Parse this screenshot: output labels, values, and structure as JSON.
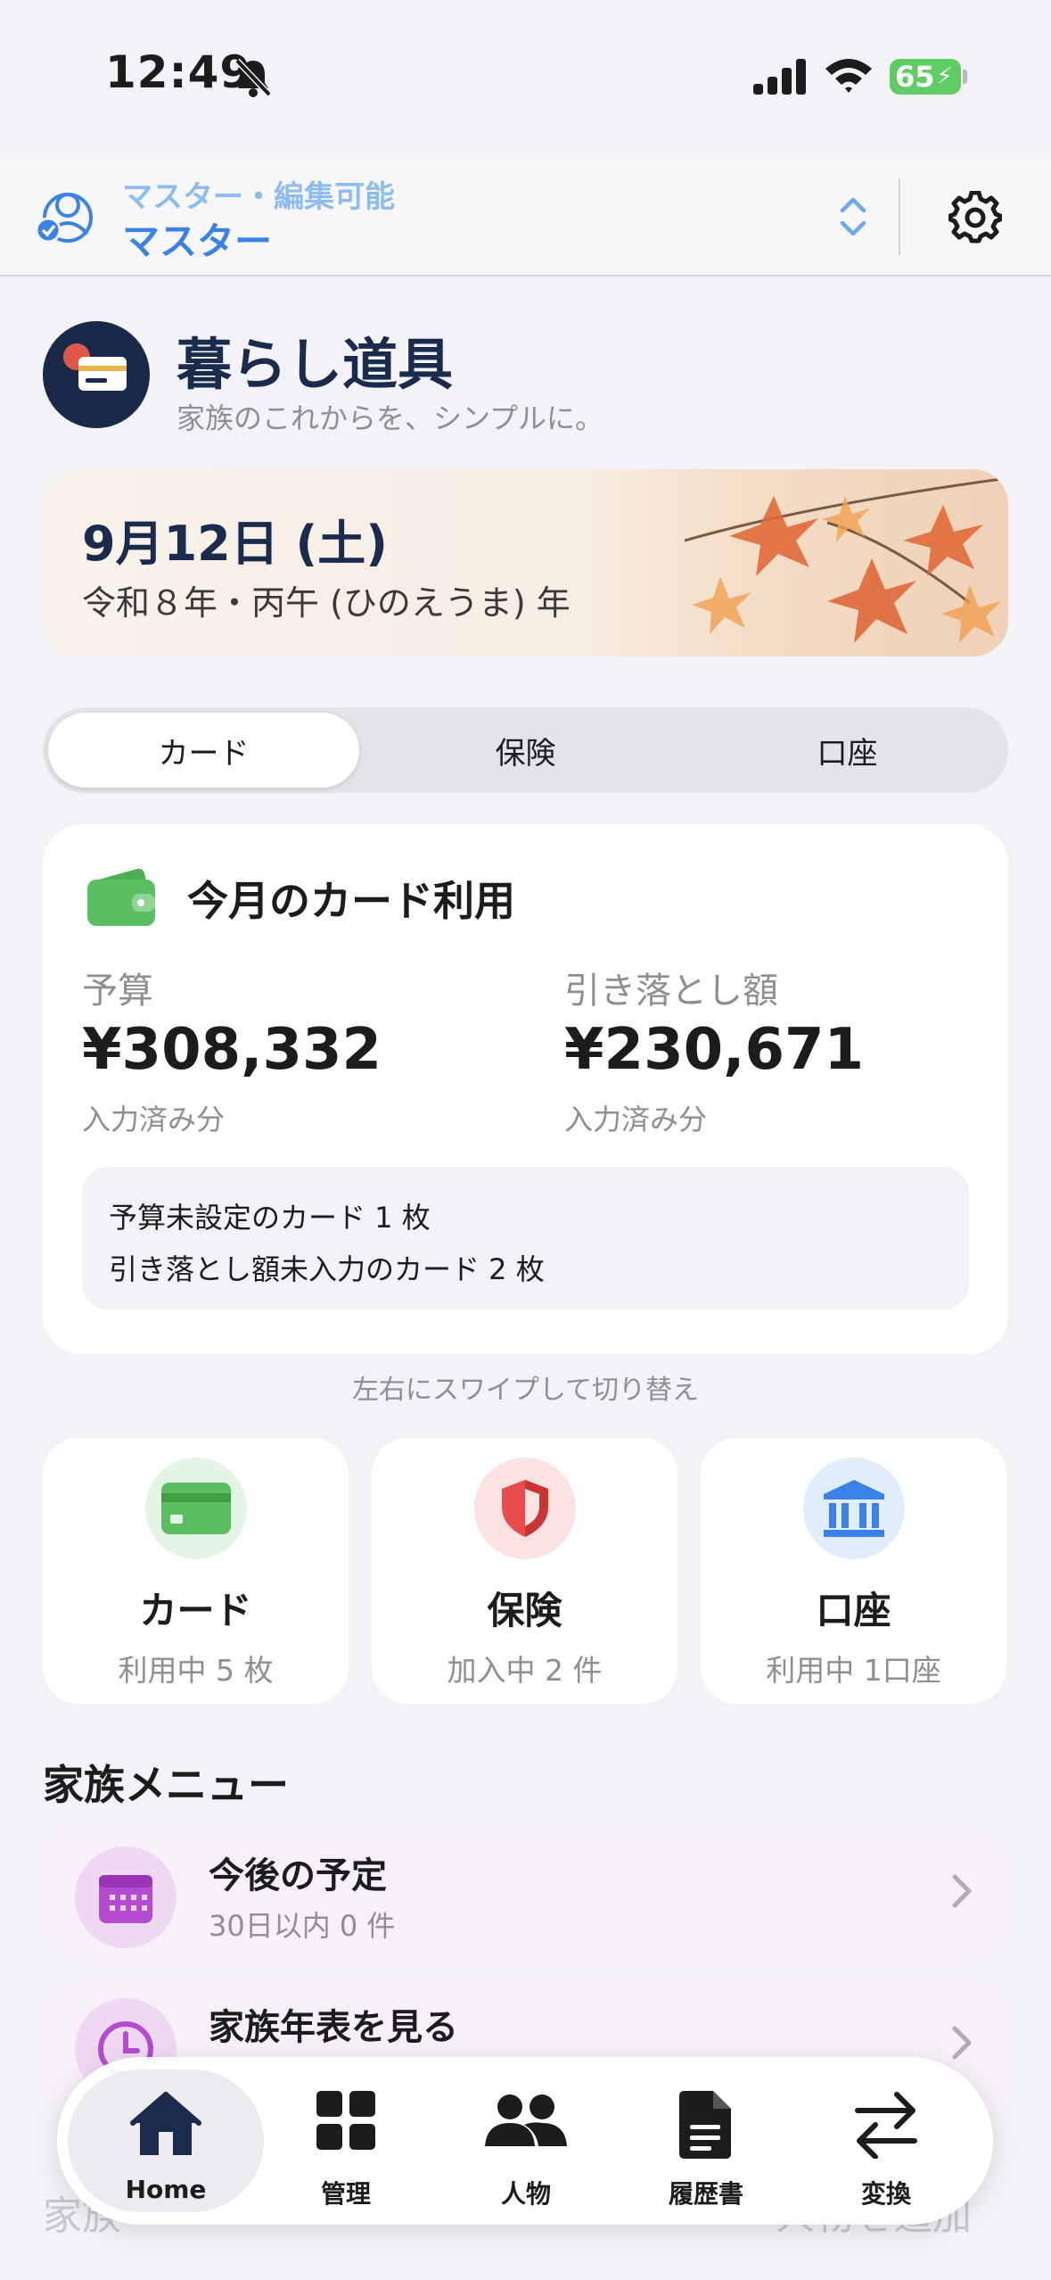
{
  "status": {
    "time": "12:49",
    "battery": "65"
  },
  "header": {
    "mode_sub": "マスター・編集可能",
    "mode_main": "マスター"
  },
  "brand": {
    "title": "暮らし道具",
    "subtitle": "家族のこれからを、シンプルに。"
  },
  "date": {
    "main": "9月12日 (土)",
    "sub": "令和８年・丙午 (ひのえうま) 年"
  },
  "segments": [
    "カード",
    "保険",
    "口座"
  ],
  "card_panel": {
    "title": "今月のカード利用",
    "budget_label": "予算",
    "budget_value": "¥308,332",
    "budget_note": "入力済み分",
    "debit_label": "引き落とし額",
    "debit_value": "¥230,671",
    "debit_note": "入力済み分",
    "info_1": "予算未設定のカード 1 枚",
    "info_2": "引き落とし額未入力のカード 2 枚"
  },
  "swipe_hint": "左右にスワイプして切り替え",
  "tiles": [
    {
      "label": "カード",
      "sub": "利用中 5 枚",
      "icon": "credit-card-icon",
      "color": "#5bbf62"
    },
    {
      "label": "保険",
      "sub": "加入中 2 件",
      "icon": "shield-icon",
      "color": "#e84c4c"
    },
    {
      "label": "口座",
      "sub": "利用中 1口座",
      "icon": "bank-icon",
      "color": "#3b82e8"
    }
  ],
  "family_menu": {
    "title": "家族メニュー",
    "items": [
      {
        "title": "今後の予定",
        "sub": "30日以内 0 件",
        "icon": "calendar-icon"
      },
      {
        "title": "家族年表を見る",
        "icon": "clock-icon"
      }
    ]
  },
  "faded_bottom": {
    "left": "家族",
    "right": "人物を追加"
  },
  "tabbar": [
    {
      "label": "Home",
      "icon": "home-icon"
    },
    {
      "label": "管理",
      "icon": "grid-icon"
    },
    {
      "label": "人物",
      "icon": "people-icon"
    },
    {
      "label": "履歴書",
      "icon": "document-icon"
    },
    {
      "label": "変換",
      "icon": "arrows-icon"
    }
  ]
}
